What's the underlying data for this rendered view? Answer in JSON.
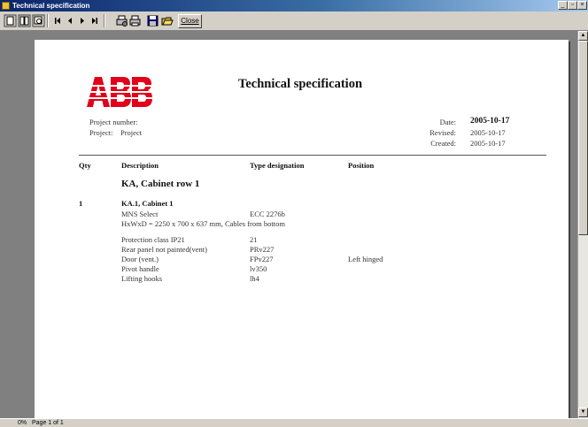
{
  "window": {
    "title": "Technical specification",
    "controls": [
      "_",
      "▫",
      "×"
    ]
  },
  "toolbar": {
    "close_label": "Close",
    "icons": [
      "single-page-icon",
      "two-page-icon",
      "zoom-icon",
      "first-page-icon",
      "prev-page-icon",
      "next-page-icon",
      "last-page-icon",
      "print-setup-icon",
      "print-icon",
      "save-icon",
      "open-icon"
    ]
  },
  "status": {
    "zoom": "0%",
    "page": "Page 1 of 1"
  },
  "document": {
    "title": "Technical specification",
    "brand_colors": {
      "logo": "#e2001a"
    },
    "project_number_label": "Project number:",
    "project_label": "Project:",
    "project_value": "Project",
    "date_label": "Date:",
    "date_value": "2005-10-17",
    "revised_label": "Revised:",
    "revised_value": "2005-10-17",
    "created_label": "Created:",
    "created_value": "2005-10-17",
    "columns": [
      "Qty",
      "Description",
      "Type designation",
      "Position"
    ],
    "section_title": "KA, Cabinet row 1",
    "item": {
      "qty": "1",
      "name": "KA.1, Cabinet 1",
      "line1_desc": "MNS Select",
      "line1_type": "ECC 2276b",
      "line2_desc": "HxWxD = 2250 x 700 x 637 mm, Cables from bottom",
      "rows": [
        {
          "desc": "Protection class IP21",
          "type": "21",
          "position": ""
        },
        {
          "desc": "Rear panel not painted(vent)",
          "type": "PRv227",
          "position": ""
        },
        {
          "desc": "Door (vent.)",
          "type": "FPv227",
          "position": "Left hinged"
        },
        {
          "desc": "Pivot handle",
          "type": "lv350",
          "position": ""
        },
        {
          "desc": "Lifting hooks",
          "type": "lh4",
          "position": ""
        }
      ]
    }
  }
}
